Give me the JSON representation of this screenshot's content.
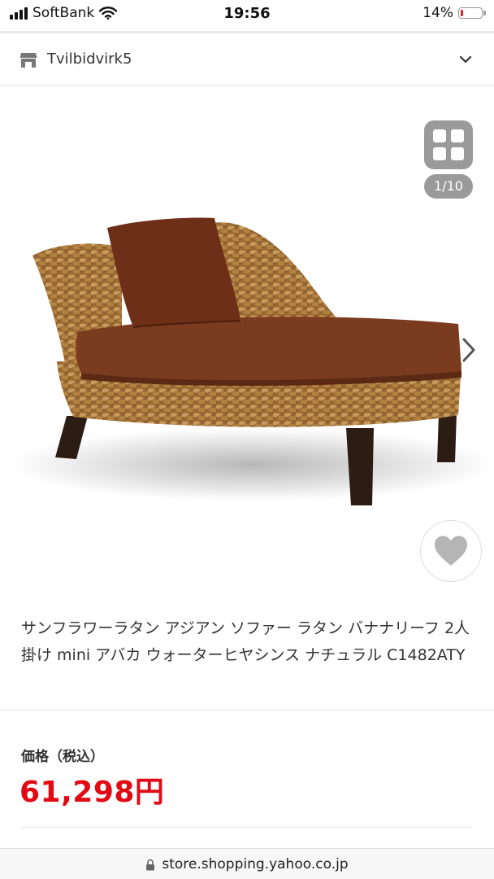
{
  "status_bar": {
    "carrier": "SoftBank",
    "time": "19:56",
    "battery_percent": "14%",
    "battery_level": 0.14,
    "battery_color": "#e02020"
  },
  "store": {
    "icon": "store-icon",
    "name": "Tvilbidvirk5",
    "menu_icon": "chevron-down-icon"
  },
  "gallery": {
    "grid_icon": "grid-icon",
    "counter": "1/10",
    "next_icon": "chevron-right-icon",
    "favorite_icon": "heart-icon"
  },
  "product": {
    "title": "サンフラワーラタン アジアン ソファー ラタン バナナリーフ 2人掛け mini アバカ ウォーターヒヤシンス ナチュラル C1482ATY",
    "price_label": "価格（税込）",
    "price": "61,298円",
    "price_color": "#e10a14"
  },
  "url_bar": {
    "lock_icon": "lock-icon",
    "url": "store.shopping.yahoo.co.jp"
  }
}
